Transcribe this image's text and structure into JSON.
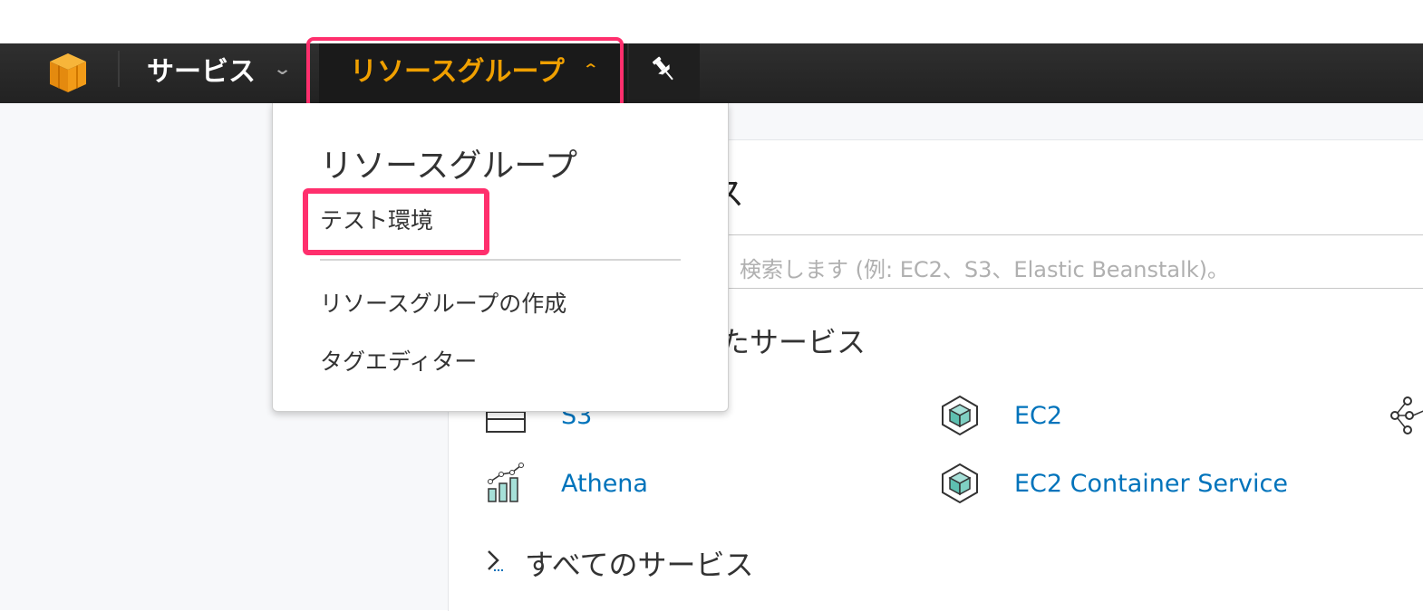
{
  "topnav": {
    "services_label": "サービス",
    "resource_groups_label": "リソースグループ"
  },
  "dropdown": {
    "header": "リソースグループ",
    "groups": [
      "テスト環境"
    ],
    "create_label": "リソースグループの作成",
    "tag_editor_label": "タグエディター"
  },
  "console": {
    "title_visible": "ス",
    "search_placeholder": "検索します (例: EC2、S3、Elastic Beanstalk)。",
    "recent_title_visible": "たサービス",
    "services": [
      "S3",
      "EC2",
      "Athena",
      "EC2 Container Service"
    ],
    "all_services_label": "すべてのサービス"
  },
  "colors": {
    "nav_bg": "#232323",
    "accent_orange": "#f0a000",
    "link_blue": "#0073bb",
    "highlight_pink": "#ff2f6d"
  }
}
